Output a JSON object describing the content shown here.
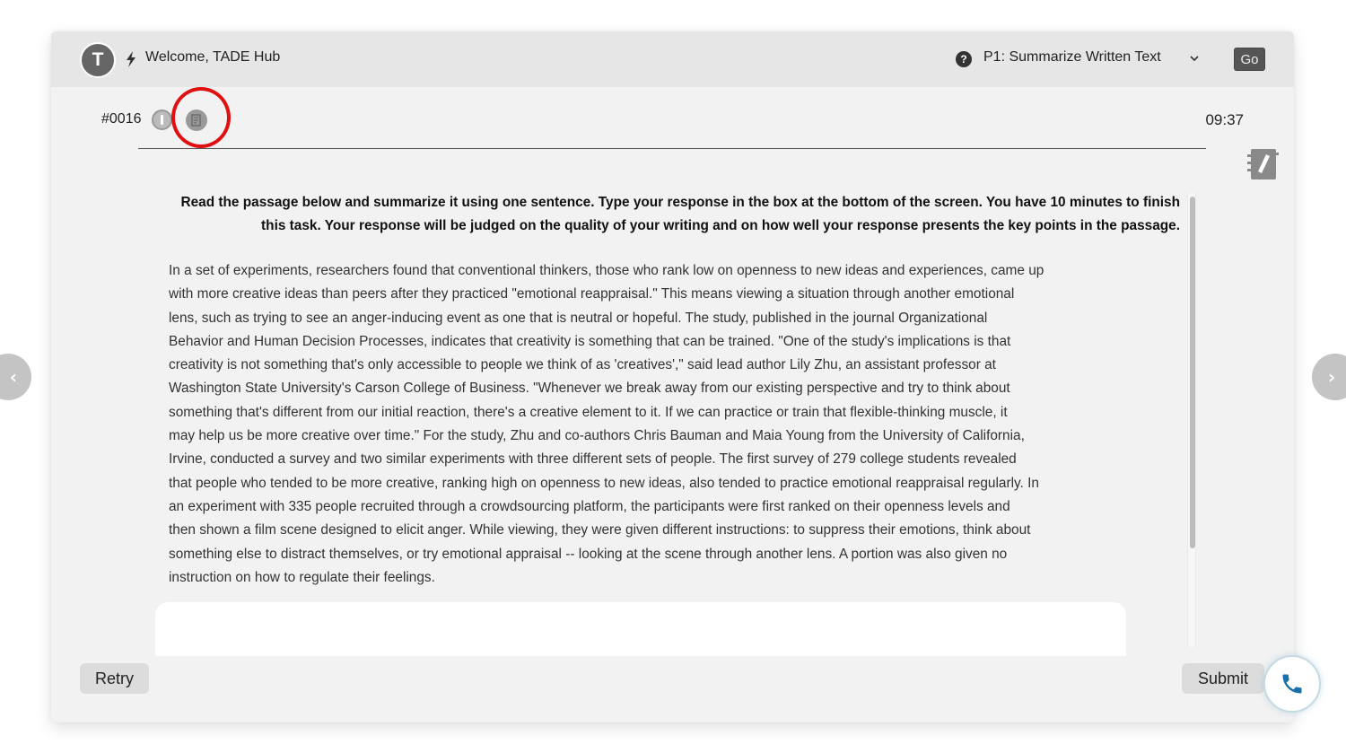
{
  "header": {
    "avatar_letter": "T",
    "welcome_text": "Welcome, TADE Hub",
    "task_selector": {
      "selected": "P1: Summarize Written Text"
    },
    "go_label": "Go"
  },
  "question": {
    "number": "#0016",
    "timer": "09:37",
    "instructions": "Read the passage below and summarize it using one sentence. Type your response in the box at the bottom of the screen. You have 10 minutes to finish this task. Your response will be judged on the quality of your writing and on how well your response presents the key points in the passage.",
    "passage_lines": [
      "In a set of experiments, researchers found that conventional thinkers, those who rank low on openness to new ideas and experiences, came up",
      "with more creative ideas than peers after they practiced \"emotional reappraisal.\" This means viewing a situation through another emotional",
      "lens, such as trying to see an anger-inducing event as one that is neutral or hopeful. The study, published in the journal Organizational",
      "Behavior and Human Decision Processes, indicates that creativity is something that can be trained. \"One of the study's implications is that",
      "creativity is not something that's only accessible to people we think of as 'creatives',\" said lead author Lily Zhu, an assistant professor at",
      "Washington State University's Carson College of Business. \"Whenever we break away from our existing perspective and try to think about",
      "something that's different from our initial reaction, there's a creative element to it. If we can practice or train that flexible-thinking muscle, it",
      "may help us be more creative over time.\" For the study, Zhu and co-authors Chris Bauman and Maia Young from the University of California,",
      "Irvine, conducted a survey and two similar experiments with three different sets of people. The first survey of 279 college students revealed",
      "that people who tended to be more creative, ranking high on openness to new ideas, also tended to practice emotional reappraisal regularly. In",
      "an experiment with 335 people recruited through a crowdsourcing platform, the participants were first ranked on their openness levels and",
      "then shown a film scene designed to elicit anger. While viewing, they were given different instructions: to suppress their emotions, think about",
      "something else to distract themselves, or try emotional appraisal -- looking at the scene through another lens. A portion was also given no",
      "instruction on how to regulate their feelings."
    ],
    "response_value": ""
  },
  "footer": {
    "retry_label": "Retry",
    "submit_label": "Submit"
  },
  "icons": {
    "avatar": "user-avatar",
    "bolt": "lightning-icon",
    "help": "question-circle-icon",
    "chevron": "chevron-down-icon",
    "info": "info-icon",
    "note": "note-icon",
    "notebook": "notebook-pen-icon",
    "call": "phone-icon",
    "prev": "chevron-left-icon",
    "next": "chevron-right-icon"
  },
  "colors": {
    "highlight_ring": "#e01010",
    "phone_icon": "#1a6fa8",
    "go_button": "#555555"
  }
}
